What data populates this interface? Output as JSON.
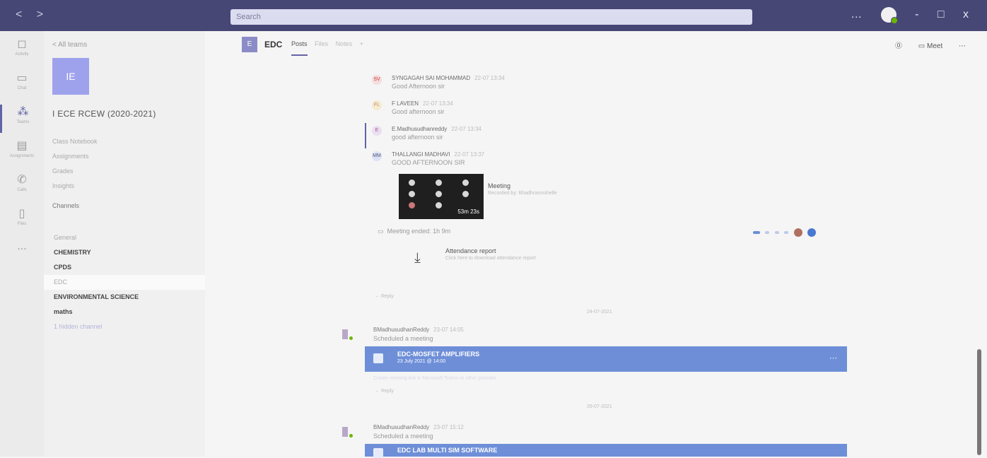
{
  "titlebar": {
    "nav": "< >",
    "search_placeholder": "Search",
    "controls": [
      "-",
      "□",
      "x"
    ]
  },
  "rail": {
    "items": [
      {
        "label": "Activity",
        "icon": "bell-icon"
      },
      {
        "label": "Chat",
        "icon": "chat-icon"
      },
      {
        "label": "Teams",
        "icon": "teams-icon"
      },
      {
        "label": "Assignments",
        "icon": "assignments-icon"
      },
      {
        "label": "Calls",
        "icon": "phone-icon"
      },
      {
        "label": "Files",
        "icon": "file-icon"
      },
      {
        "label": "...",
        "icon": "more-icon"
      }
    ]
  },
  "sidebar": {
    "back": "< All teams",
    "team_initials": "IE",
    "team_name": "I ECE RCEW (2020-2021)",
    "links": [
      "Class Notebook",
      "Assignments",
      "Grades",
      "Insights"
    ],
    "channels_header": "Channels",
    "channels": [
      {
        "label": "General",
        "style": "dim"
      },
      {
        "label": "CHEMISTRY",
        "style": "bold"
      },
      {
        "label": "CPDS",
        "style": "bold"
      },
      {
        "label": "EDC",
        "style": "selected"
      },
      {
        "label": "ENVIRONMENTAL SCIENCE",
        "style": "bold"
      },
      {
        "label": "maths",
        "style": "bold"
      },
      {
        "label": "1 hidden channel",
        "style": "dim"
      }
    ]
  },
  "header": {
    "icon": "E",
    "title": "EDC",
    "tabs": [
      "Posts",
      "Files",
      "Notes",
      "+"
    ],
    "meet": "Meet"
  },
  "posts": [
    {
      "initials": "SV",
      "name": "SYNGAGAH SAI MOHAMMAD",
      "time": "22-07 13:34",
      "text": "Good Afternoon sir"
    },
    {
      "initials": "FL",
      "name": "F LAVEEN",
      "time": "22-07 13:34",
      "text": "Good afternoon sir"
    },
    {
      "initials": "E",
      "name": "E.Madhusudhanreddy",
      "time": "22-07 13:34",
      "text": "good afternoon sir"
    },
    {
      "initials": "MM",
      "name": "THALLANGI MADHAVI",
      "time": "22-07 13:37",
      "text": "GOOD AFTERNOON SIR"
    }
  ],
  "meeting": {
    "title": "Meeting",
    "subtitle": "Recorded by: Bhadhrasmshelle",
    "duration": "53m 23s",
    "ended": "Meeting ended: 1h 9m"
  },
  "attendance": {
    "title": "Attendance report",
    "subtitle": "Click here to download attendance report"
  },
  "reply_label": "← Reply",
  "dates": [
    "24-07-2021",
    "26-07-2021"
  ],
  "scheduled": [
    {
      "name": "BMadhusudhanReddy",
      "time": "23-07 14:05",
      "text": "Scheduled a meeting",
      "card_title": "EDC-MOSFET AMPLIFIERS",
      "card_sub": "23 July 2021 @ 14:00",
      "note": "Create meeting link in Microsoft Teams or other provider"
    },
    {
      "name": "BMadhusudhanReddy",
      "time": "23-07 15:12",
      "text": "Scheduled a meeting",
      "card_title": "EDC LAB MULTI SIM SOFTWARE",
      "card_sub": "",
      "note": ""
    }
  ],
  "colors": {
    "titlebar": "#464775",
    "accent": "#6264a7",
    "card": "#6e8fd8",
    "team_tile": "#9ea2ec"
  }
}
